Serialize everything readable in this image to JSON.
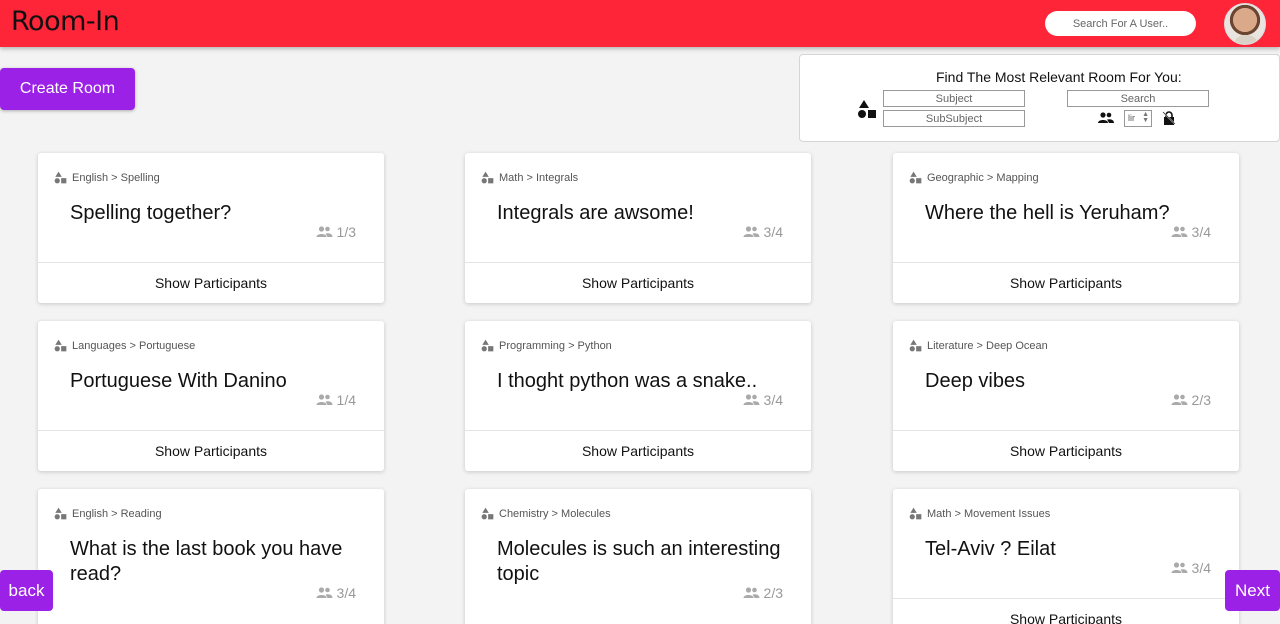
{
  "header": {
    "brand": "Room-In",
    "user_search_placeholder": "Search For A User..",
    "accent_color": "#fd2537"
  },
  "actions": {
    "create_room": "Create Room",
    "back": "back",
    "next": "Next"
  },
  "filter": {
    "title": "Find The Most Relevant Room For You:",
    "subject_placeholder": "Subject",
    "subsubject_placeholder": "SubSubject",
    "search_placeholder": "Search",
    "limit_value": "lir"
  },
  "rooms": [
    {
      "category": "English > Spelling",
      "title": "Spelling together?",
      "count": "1/3",
      "action": "Show Participants"
    },
    {
      "category": "Math > Integrals",
      "title": "Integrals are awsome!",
      "count": "3/4",
      "action": "Show Participants"
    },
    {
      "category": "Geographic > Mapping",
      "title": "Where the hell is Yeruham?",
      "count": "3/4",
      "action": "Show Participants"
    },
    {
      "category": "Languages > Portuguese",
      "title": "Portuguese With Danino",
      "count": "1/4",
      "action": "Show Participants"
    },
    {
      "category": "Programming > Python",
      "title": "I thoght python was a snake..",
      "count": "3/4",
      "action": "Show Participants"
    },
    {
      "category": "Literature > Deep Ocean",
      "title": "Deep vibes",
      "count": "2/3",
      "action": "Show Participants"
    },
    {
      "category": "English > Reading",
      "title": "What is the last book you have read?",
      "count": "3/4",
      "action": "Show Participants"
    },
    {
      "category": "Chemistry > Molecules",
      "title": "Molecules is such an interesting topic",
      "count": "2/3",
      "action": "Show Participants"
    },
    {
      "category": "Math > Movement Issues",
      "title": "Tel-Aviv ? Eilat",
      "count": "3/4",
      "action": "Show Participants"
    }
  ]
}
